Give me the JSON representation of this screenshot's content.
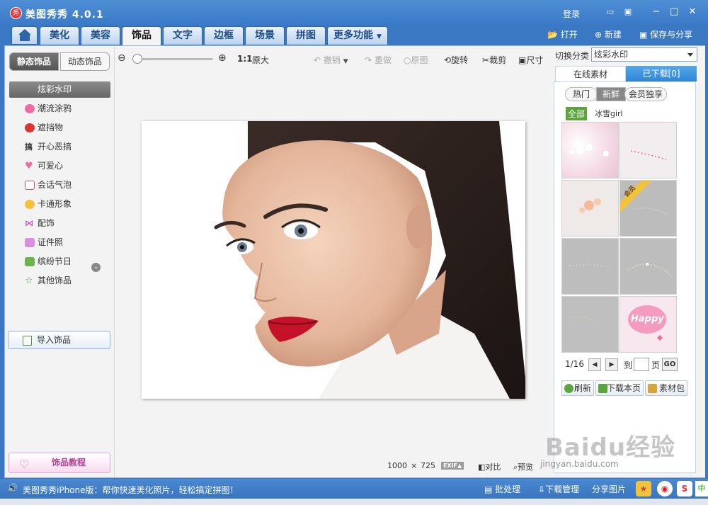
{
  "app": {
    "title": "美图秀秀 4.0.1",
    "logo_text": "秀",
    "login": "登录"
  },
  "nav": {
    "tabs": [
      "美化",
      "美容",
      "饰品",
      "文字",
      "边框",
      "场景",
      "拼图",
      "更多功能"
    ],
    "active": "饰品",
    "actions": {
      "open": "打开",
      "new": "新建",
      "save_share": "保存与分享"
    }
  },
  "left": {
    "subtabs": [
      "静态饰品",
      "动态饰品"
    ],
    "categories": [
      "炫彩水印",
      "潮流涂鸦",
      "遮挡物",
      "开心恶搞",
      "可爱心",
      "会话气泡",
      "卡通形象",
      "配饰",
      "证件照",
      "缤纷节日",
      "其他饰品"
    ],
    "import_label": "导入饰品",
    "tutorial_label": "饰品教程"
  },
  "toolbar": {
    "zoom_ratio": "1:1",
    "original_size": "原大",
    "undo": "撤销",
    "redo": "重做",
    "original_image": "原图",
    "rotate": "旋转",
    "crop": "裁剪",
    "resize": "尺寸"
  },
  "canvas": {
    "width": "1000",
    "sep": "×",
    "height": "725",
    "exif": "EXIF▲",
    "compare": "对比",
    "preview": "预览"
  },
  "right": {
    "switch_label": "切换分类",
    "switch_value": "炫彩水印",
    "tabs": [
      "在线素材",
      "已下载[0]"
    ],
    "pills": [
      "热门",
      "新鲜",
      "会员独享"
    ],
    "filter_all": "全部",
    "filter_name": "冰雪girl",
    "member_badge": "会员",
    "happy_text": "Happy",
    "page": "1/16",
    "goto": "到",
    "page_unit": "页",
    "go": "GO",
    "buttons": [
      "刷新",
      "下载本页",
      "素材包"
    ]
  },
  "status": {
    "text": "美图秀秀iPhone版：帮你快速美化照片，轻松搞定拼图！",
    "batch": "批处理",
    "download_mgr": "下载管理",
    "share_img": "分享图片"
  },
  "watermark": {
    "brand": "Baidu经验",
    "url": "jingyan.baidu.com"
  }
}
